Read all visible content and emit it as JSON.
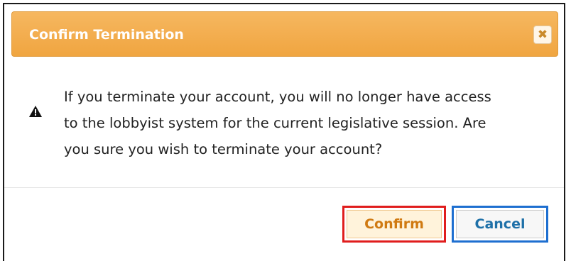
{
  "dialog": {
    "title": "Confirm Termination",
    "close_icon": "close-icon",
    "warning_icon": "warning-icon",
    "message_lines": [
      "If you terminate your account, you will no longer have access",
      "to the lobbyist system for the current legislative session. Are",
      "you sure you wish to terminate your account?"
    ],
    "close_glyph": "✖"
  },
  "buttons": {
    "confirm_label": "Confirm",
    "cancel_label": "Cancel"
  },
  "colors": {
    "titlebar": "#f0a540",
    "confirm_highlight": "#e01d1d",
    "cancel_highlight": "#1e6fd0",
    "confirm_text": "#d07a12",
    "cancel_text": "#1e70a8"
  }
}
